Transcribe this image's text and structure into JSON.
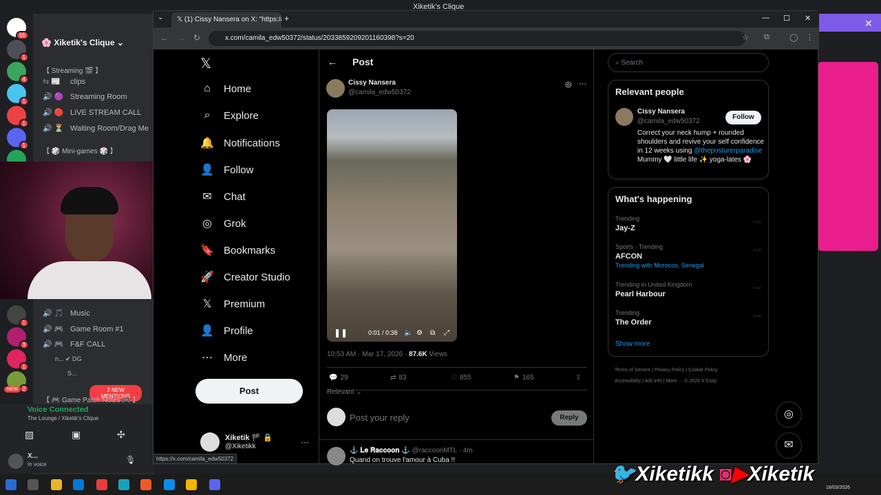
{
  "discord": {
    "window_title": "Xiketik's Clique",
    "guild_name": "Xiketik's Clique",
    "categories": [
      "【 Streaming 🎬 】",
      "【 🎲 Mini-games 🎲 】",
      "【 🎮 Game Patch Notes 🎮 】"
    ],
    "channels_top": [
      {
        "icon": "⇆ 📰",
        "name": "clips"
      },
      {
        "icon": "🔊 🟣",
        "name": "Streaming Room"
      },
      {
        "icon": "🔊 🔴",
        "name": "LIVE STREAM CALL"
      },
      {
        "icon": "🔊 ⏳",
        "name": "Waiting Room/Drag Me"
      }
    ],
    "channels_bottom": [
      {
        "icon": "🔊 🎵",
        "name": "Music"
      },
      {
        "icon": "🔊 🎮",
        "name": "Game Room #1"
      },
      {
        "icon": "🔊 🎮",
        "name": "F&F CALL"
      }
    ],
    "members": [
      "n...  ✔ DG",
      "S..."
    ],
    "mentions": "2 NEW MENTIONS",
    "voice_status": "Voice Connected",
    "voice_channel": "The Lounge / Xiketik's Clique",
    "user_name": "X...",
    "user_status": "In voice",
    "link_hover": "https://x.com/camila_edw50372",
    "server_badges": [
      "55",
      "1",
      "4",
      "1",
      "1",
      "1",
      "1",
      "1",
      "3",
      "1",
      "2",
      "NEW"
    ]
  },
  "browser": {
    "tab_title": "(1) Cissy Nansera on X: \"https://",
    "url": "x.com/camila_edw50372/status/2033859209201160398?s=20"
  },
  "x": {
    "nav": [
      {
        "icon": "⌂",
        "label": "Home"
      },
      {
        "icon": "⌕",
        "label": "Explore"
      },
      {
        "icon": "🔔",
        "label": "Notifications"
      },
      {
        "icon": "👤",
        "label": "Follow"
      },
      {
        "icon": "✉",
        "label": "Chat"
      },
      {
        "icon": "◎",
        "label": "Grok"
      },
      {
        "icon": "🔖",
        "label": "Bookmarks"
      },
      {
        "icon": "🚀",
        "label": "Creator Studio"
      },
      {
        "icon": "𝕏",
        "label": "Premium"
      },
      {
        "icon": "👤",
        "label": "Profile"
      },
      {
        "icon": "⋯",
        "label": "More"
      }
    ],
    "post_button": "Post",
    "account": {
      "name": "Xiketik 🏴 🔒",
      "handle": "@Xiketikk"
    },
    "header": "Post",
    "tweet": {
      "author": "Cissy Nansera",
      "handle": "@camila_edw50372",
      "video_time": "0:01 / 0:38",
      "timestamp": "10:53 AM · Mar 17, 2026 · ",
      "views_count": "87.6K",
      "views_label": " Views",
      "replies": "29",
      "retweets": "83",
      "likes": "855",
      "bookmarks": "165",
      "sort": "Relevant ⌄",
      "reply_placeholder": "Post your reply",
      "reply_button": "Reply"
    },
    "next_reply": {
      "name": "⚓ 𝐋𝐞 𝐑𝐚𝐜𝐜𝐨𝐨𝐧 ⚓",
      "handle": "@raccoonMTL · 4m",
      "text": "Quand on trouve l'amour à Cuba !!"
    },
    "search_placeholder": "Search",
    "relevant_people_title": "Relevant people",
    "person": {
      "name": "Cissy Nansera",
      "handle": "@camila_edw50372",
      "follow": "Follow",
      "bio": "Correct your neck hump + rounded shoulders and revive your self confidence in 12 weeks using",
      "bio_link": "@theposturerparadise",
      "bio_tail": " Mummy 🤍 little life ✨ yoga-lates 🌸"
    },
    "whats_happening": "What's happening",
    "trends": [
      {
        "context": "Trending",
        "name": "Jay-Z",
        "extra": ""
      },
      {
        "context": "Sports · Trending",
        "name": "AFCON",
        "extra": "Trending with  Morocco, Senegal"
      },
      {
        "context": "Trending in United Kingdom",
        "name": "Pearl Harbour",
        "extra": ""
      },
      {
        "context": "Trending",
        "name": "The Order",
        "extra": ""
      }
    ],
    "show_more": "Show more",
    "footer": [
      "Terms of Service",
      "Privacy Policy",
      "Cookie Policy",
      "Accessibility",
      "Ads info",
      "More ···",
      "© 2026 X Corp."
    ]
  },
  "overlay": {
    "brand1": "Xiketikk",
    "brand2": "Xiketik",
    "date": "18/03/2026"
  },
  "colors": {
    "discord_accent": "#7c5ce8",
    "x_link": "#1d9bf0",
    "pink": "#e91e8c"
  }
}
